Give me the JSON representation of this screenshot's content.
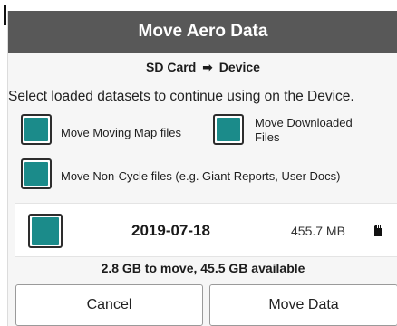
{
  "dialog": {
    "title": "Move Aero Data",
    "route": {
      "from": "SD Card",
      "arrow": "➡",
      "to": "Device"
    },
    "instructions": "Select loaded datasets to continue using on the Device.",
    "accent_color": "#1b8b8a",
    "header_color": "#585858"
  },
  "options": {
    "moving_map": {
      "label": "Move Moving Map files",
      "checked": true
    },
    "downloaded": {
      "label_line1": "Move Downloaded",
      "label_line2": "Files",
      "checked": true
    },
    "non_cycle": {
      "label": "Move Non-Cycle files (e.g. Giant Reports, User Docs)",
      "checked": true
    }
  },
  "datasets": [
    {
      "date": "2019-07-18",
      "size": "455.7 MB",
      "icon": "sd-card-icon",
      "checked": true
    }
  ],
  "summary": "2.8 GB to move, 45.5 GB available",
  "buttons": {
    "cancel": "Cancel",
    "move": "Move Data"
  }
}
